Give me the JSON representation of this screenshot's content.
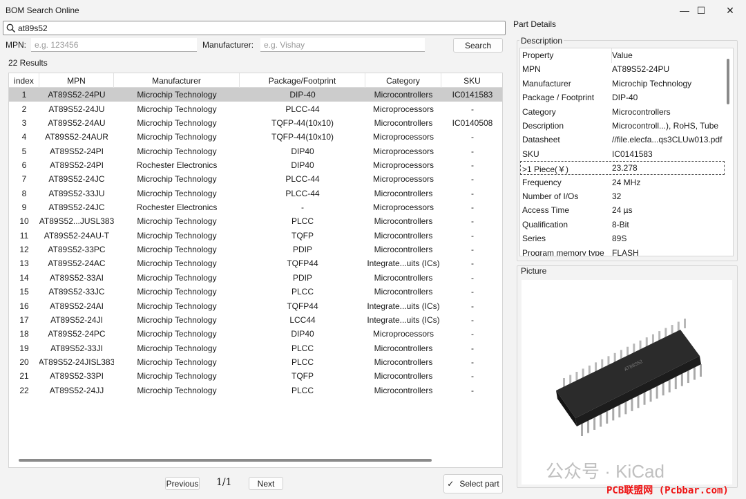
{
  "window": {
    "title": "BOM Search Online",
    "minimize": "—",
    "maximize": "☐",
    "close": "✕"
  },
  "search": {
    "value": "at89s52"
  },
  "filters": {
    "mpn_label": "MPN:",
    "mpn_placeholder": "e.g. 123456",
    "manufacturer_label": "Manufacturer:",
    "manufacturer_placeholder": "e.g. Vishay",
    "search_button": "Search"
  },
  "results_label": "22 Results",
  "table": {
    "columns": [
      "index",
      "MPN",
      "Manufacturer",
      "Package/Footprint",
      "Category",
      "SKU"
    ],
    "rows": [
      [
        "1",
        "AT89S52-24PU",
        "Microchip Technology",
        "DIP-40",
        "Microcontrollers",
        "IC0141583"
      ],
      [
        "2",
        "AT89S52-24JU",
        "Microchip Technology",
        "PLCC-44",
        "Microprocessors",
        "-"
      ],
      [
        "3",
        "AT89S52-24AU",
        "Microchip Technology",
        "TQFP-44(10x10)",
        "Microcontrollers",
        "IC0140508"
      ],
      [
        "4",
        "AT89S52-24AUR",
        "Microchip Technology",
        "TQFP-44(10x10)",
        "Microprocessors",
        "-"
      ],
      [
        "5",
        "AT89S52-24PI",
        "Microchip Technology",
        "DIP40",
        "Microprocessors",
        "-"
      ],
      [
        "6",
        "AT89S52-24PI",
        "Rochester Electronics",
        "DIP40",
        "Microprocessors",
        "-"
      ],
      [
        "7",
        "AT89S52-24JC",
        "Microchip Technology",
        "PLCC-44",
        "Microprocessors",
        "-"
      ],
      [
        "8",
        "AT89S52-33JU",
        "Microchip Technology",
        "PLCC-44",
        "Microcontrollers",
        "-"
      ],
      [
        "9",
        "AT89S52-24JC",
        "Rochester Electronics",
        "-",
        "Microprocessors",
        "-"
      ],
      [
        "10",
        "AT89S52...JUSL383",
        "Microchip Technology",
        "PLCC",
        "Microcontrollers",
        "-"
      ],
      [
        "11",
        "AT89S52-24AU-T",
        "Microchip Technology",
        "TQFP",
        "Microcontrollers",
        "-"
      ],
      [
        "12",
        "AT89S52-33PC",
        "Microchip Technology",
        "PDIP",
        "Microcontrollers",
        "-"
      ],
      [
        "13",
        "AT89S52-24AC",
        "Microchip Technology",
        "TQFP44",
        "Integrate...uits (ICs)",
        "-"
      ],
      [
        "14",
        "AT89S52-33AI",
        "Microchip Technology",
        "PDIP",
        "Microcontrollers",
        "-"
      ],
      [
        "15",
        "AT89S52-33JC",
        "Microchip Technology",
        "PLCC",
        "Microcontrollers",
        "-"
      ],
      [
        "16",
        "AT89S52-24AI",
        "Microchip Technology",
        "TQFP44",
        "Integrate...uits (ICs)",
        "-"
      ],
      [
        "17",
        "AT89S52-24JI",
        "Microchip Technology",
        "LCC44",
        "Integrate...uits (ICs)",
        "-"
      ],
      [
        "18",
        "AT89S52-24PC",
        "Microchip Technology",
        "DIP40",
        "Microprocessors",
        "-"
      ],
      [
        "19",
        "AT89S52-33JI",
        "Microchip Technology",
        "PLCC",
        "Microcontrollers",
        "-"
      ],
      [
        "20",
        "AT89S52-24JISL383",
        "Microchip Technology",
        "PLCC",
        "Microcontrollers",
        "-"
      ],
      [
        "21",
        "AT89S52-33PI",
        "Microchip Technology",
        "TQFP",
        "Microcontrollers",
        "-"
      ],
      [
        "22",
        "AT89S52-24JJ",
        "Microchip Technology",
        "PLCC",
        "Microcontrollers",
        "-"
      ]
    ],
    "selected_index": 0
  },
  "pager": {
    "previous": "Previous",
    "page": "1/1",
    "next": "Next"
  },
  "select_part": {
    "icon": "checkmark-icon",
    "label": "Select part"
  },
  "details": {
    "title": "Part Details",
    "description_title": "Description",
    "header": {
      "property": "Property",
      "value": "Value"
    },
    "rows": [
      [
        "MPN",
        "AT89S52-24PU"
      ],
      [
        "Manufacturer",
        "Microchip Technology"
      ],
      [
        "Package / Footprint",
        "DIP-40"
      ],
      [
        "Category",
        "Microcontrollers"
      ],
      [
        "Description",
        "Microcontroll...), RoHS, Tube"
      ],
      [
        "Datasheet",
        "//file.elecfa...qs3CLUw013.pdf"
      ],
      [
        "SKU",
        "IC0141583"
      ],
      [
        ">1 Piece(￥)",
        "23.278"
      ],
      [
        "Frequency",
        "24 MHz"
      ],
      [
        "Number of I/Os",
        "32"
      ],
      [
        "Access Time",
        "24 µs"
      ],
      [
        "Qualification",
        "8-Bit"
      ],
      [
        "Series",
        "89S"
      ],
      [
        "Program memory type",
        "FLASH"
      ]
    ],
    "focused_row": 7,
    "picture_title": "Picture",
    "chip_marking": "AT89S52"
  },
  "watermark": {
    "text": "公众号 · KiCad",
    "site": "PCB联盟网 (Pcbbar.com)"
  }
}
